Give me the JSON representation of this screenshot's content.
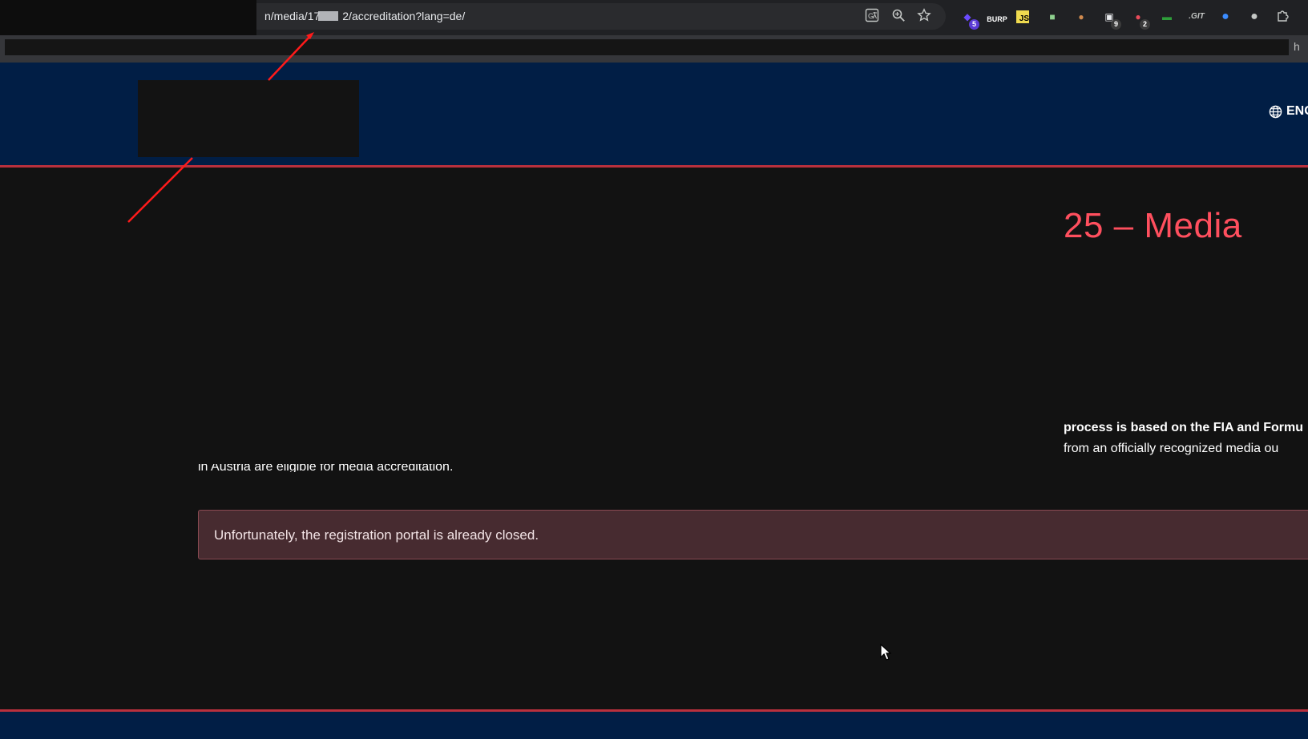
{
  "browser": {
    "url": "n/media/17  2/accreditation?lang=de/",
    "icons": [
      "translate-icon",
      "zoom-icon",
      "bookmark-star-icon"
    ],
    "extensions": [
      {
        "name": "extension-icon",
        "badge": "5"
      },
      {
        "name": "burp-extension-icon",
        "label": "BURP"
      },
      {
        "name": "js-extension-icon",
        "label": "JS"
      },
      {
        "name": "extension-icon"
      },
      {
        "name": "cookie-extension-icon"
      },
      {
        "name": "extension-icon",
        "badge": "9"
      },
      {
        "name": "extension-icon",
        "badge": "2"
      },
      {
        "name": "extension-icon"
      },
      {
        "name": "extension-icon",
        "label": ".GIT"
      },
      {
        "name": "extension-icon"
      },
      {
        "name": "extension-icon"
      },
      {
        "name": "puzzle-extensions-icon"
      }
    ],
    "bookmark_tail": "h"
  },
  "header": {
    "lang_label": "ENG",
    "colors": {
      "background": "#011e45",
      "accent": "#b9303d"
    }
  },
  "main": {
    "heading": "25 – Media",
    "intro_bold": "process is based on the FIA and Formu",
    "intro_plain": "from an officially recognized media ou",
    "clipped_line": "in Austria are eligible for media accreditation.",
    "notice": "Unfortunately, the registration portal is already closed.",
    "colors": {
      "heading": "#ff4f5e",
      "notice_bg": "#472b30"
    }
  }
}
